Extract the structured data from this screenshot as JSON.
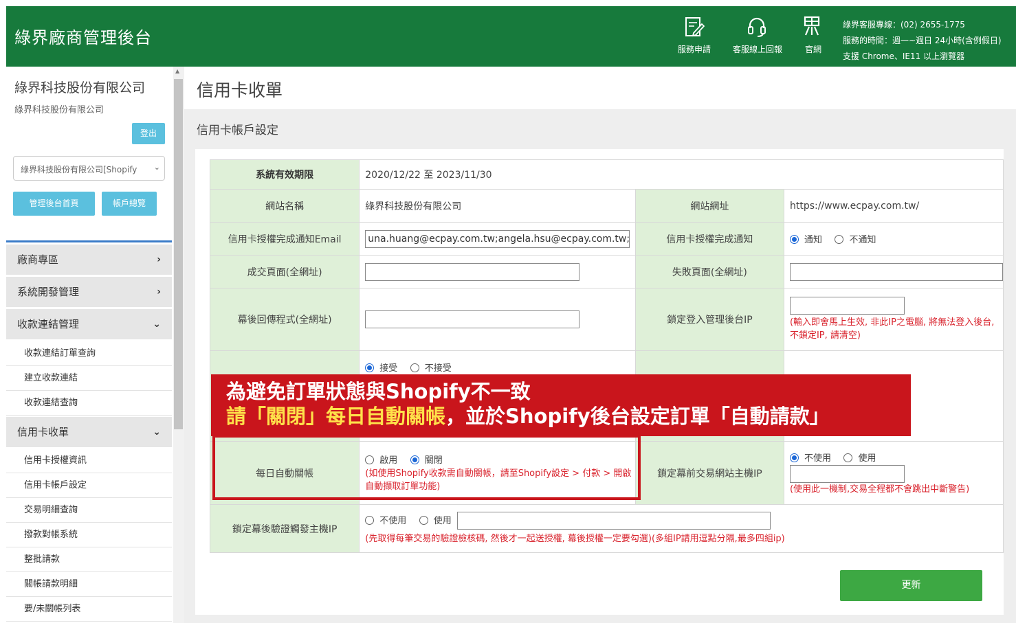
{
  "header": {
    "brand": "綠界廠商管理後台",
    "icons": [
      {
        "name": "service-apply-icon",
        "label": "服務申請"
      },
      {
        "name": "headset-icon",
        "label": "客服線上回報"
      },
      {
        "name": "ecpay-logo-icon",
        "label": "官網"
      }
    ],
    "info": [
      "綠界客服專線：(02) 2655-1775",
      "服務的時間：週一~週日 24小時(含例假日)",
      "支援 Chrome、IE11 以上瀏覽器"
    ]
  },
  "sidebar": {
    "company": "綠界科技股份有限公司",
    "company_sub": "綠界科技股份有限公司",
    "logout": "登出",
    "shop_select": "綠界科技股份有限公司[Shopify",
    "btn_home": "管理後台首頁",
    "btn_account": "帳戶總覽",
    "menu": [
      {
        "label": "廠商專區",
        "arrow": "›"
      },
      {
        "label": "系統開發管理",
        "arrow": "›"
      },
      {
        "label": "收款連結管理",
        "arrow": "⌄"
      }
    ],
    "sub1": [
      "收款連結訂單查詢",
      "建立收款連結",
      "收款連結查詢"
    ],
    "menu2": {
      "label": "信用卡收單",
      "arrow": "⌄"
    },
    "sub2": [
      "信用卡授權資訊",
      "信用卡帳戶設定",
      "交易明細查詢",
      "撥款對帳系統",
      "整批請款",
      "關帳請款明細",
      "要/未關帳列表"
    ]
  },
  "main": {
    "title": "信用卡收單",
    "subtitle": "信用卡帳戶設定",
    "rows": {
      "validity_label": "系統有效期限",
      "validity_value": "2020/12/22 至 2023/11/30",
      "site_name_label": "網站名稱",
      "site_name_value": "綠界科技股份有限公司",
      "site_url_label": "網站網址",
      "site_url_value": "https://www.ecpay.com.tw/",
      "email_label": "信用卡授權完成通知Email",
      "email_value": "una.huang@ecpay.com.tw;angela.hsu@ecpay.com.tw;ti",
      "notify_label": "信用卡授權完成通知",
      "notify_on": "通知",
      "notify_off": "不通知",
      "success_label": "成交頁面(全網址)",
      "fail_label": "失敗頁面(全網址)",
      "callback_label": "幕後回傳程式(全網址)",
      "lock_ip_label": "鎖定登入管理後台IP",
      "lock_ip_note": "(輸入即會馬上生效, 非此IP之電腦, 將無法登入後台, 不鎖定IP, 請清空)",
      "accept_on": "接受",
      "accept_off": "不接受",
      "auto_close_label": "每日自動關帳",
      "auto_close_on": "啟用",
      "auto_close_off": "關閉",
      "auto_close_note": "(如使用Shopify收款需自動關帳，請至Shopify設定 > 付款 > 開啟自動擷取訂單功能)",
      "front_ip_label": "鎖定幕前交易網站主機IP",
      "front_ip_off": "不使用",
      "front_ip_on": "使用",
      "front_ip_note": "(使用此一機制,交易全程都不會跳出中斷警告)",
      "verify_ip_label": "鎖定幕後驗證觸發主機IP",
      "verify_ip_off": "不使用",
      "verify_ip_on": "使用",
      "verify_ip_note": "(先取得每筆交易的驗證檢核碼, 然後才一起送授權, 幕後授權一定要勾選)(多組IP請用逗點分隔,最多四組ip)"
    },
    "update": "更新"
  },
  "banner": {
    "line1": "為避免訂單狀態與Shopify不一致",
    "line2_highlight": "請「關閉」每日自動關帳",
    "line2_rest": "，並於Shopify後台設定訂單「自動請款」"
  }
}
